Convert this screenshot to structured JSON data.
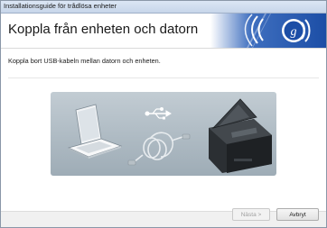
{
  "window": {
    "title": "Installationsguide för trådlösa enheter"
  },
  "header": {
    "heading": "Koppla från enheten och datorn",
    "logo_icon": "wireless-rings-icon"
  },
  "content": {
    "instruction": "Koppla bort USB-kabeln mellan datorn och enheten."
  },
  "illustration": {
    "icons": [
      "laptop-icon",
      "usb-symbol-icon",
      "usb-cable-icon",
      "printer-icon"
    ]
  },
  "buttons": {
    "next_label": "Nästa >",
    "cancel_label": "Avbryt"
  },
  "colors": {
    "banner_blue": "#1a4fa8",
    "banner_light": "#5b8bd0",
    "illustration_bg": "#aebbc4"
  }
}
